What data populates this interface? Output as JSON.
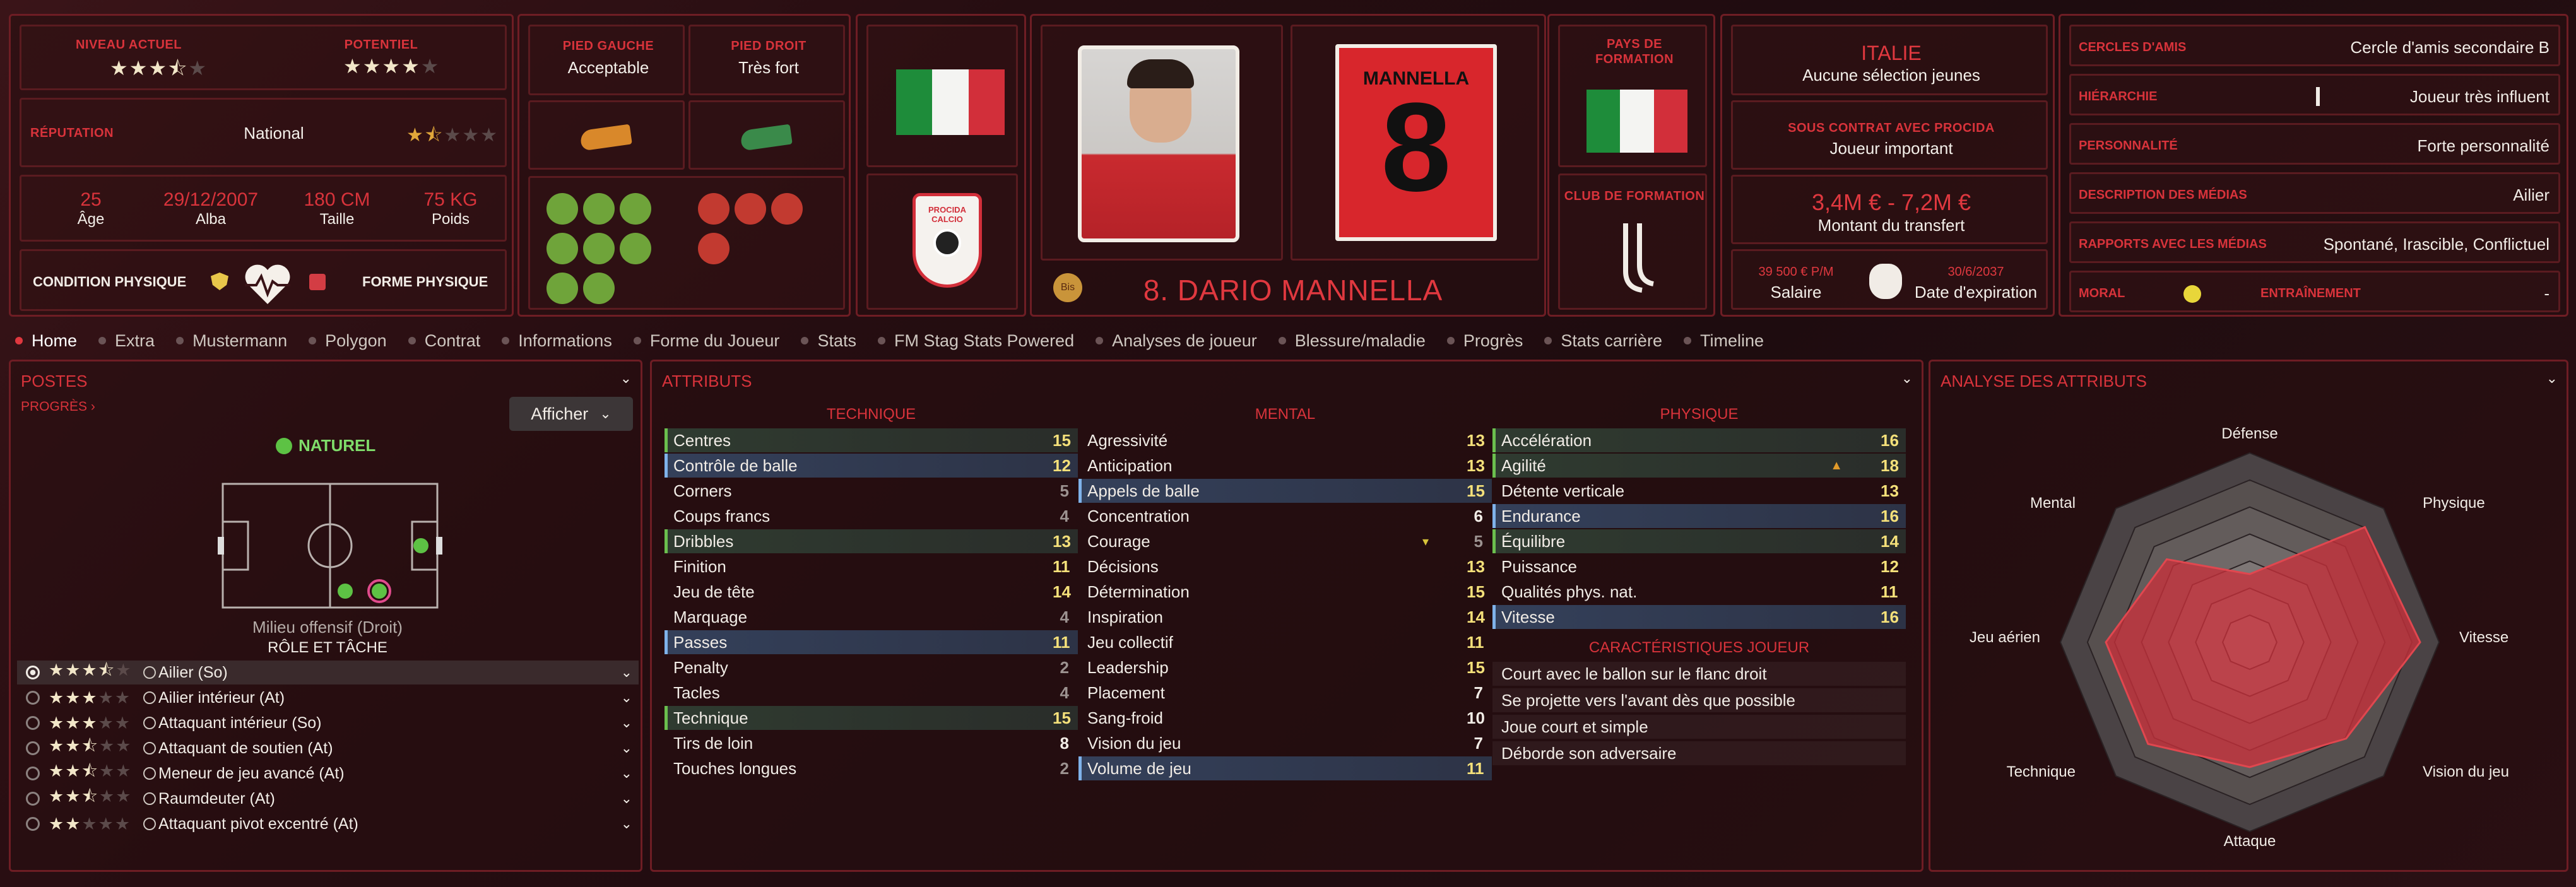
{
  "top": {
    "niveau_actuel_label": "NIVEAU ACTUEL",
    "niveau_actuel_stars": "★★★⯪",
    "niveau_actuel_empty": "★",
    "potentiel_label": "POTENTIEL",
    "potentiel_stars": "★★★★",
    "potentiel_empty": "★",
    "reputation_label": "RÉPUTATION",
    "reputation_value": "National",
    "reputation_stars": "★⯪",
    "reputation_empty": "★★★",
    "age_value": "25",
    "age_label": "Âge",
    "birth_value": "29/12/2007",
    "birth_label": "Alba",
    "height_value": "180 CM",
    "height_label": "Taille",
    "weight_value": "75 KG",
    "weight_label": "Poids",
    "condition_label": "CONDITION PHYSIQUE",
    "forme_label": "FORME PHYSIQUE",
    "pied_gauche_label": "PIED GAUCHE",
    "pied_gauche_value": "Acceptable",
    "pied_droit_label": "PIED DROIT",
    "pied_droit_value": "Très fort",
    "club_crest_text": "PROCIDA CALCIO",
    "shirt_name": "MANNELLA",
    "shirt_number": "8",
    "player_name": "8. DARIO MANNELLA",
    "player_badge": "Bis",
    "pays_formation_label": "PAYS DE FORMATION",
    "club_formation_label": "CLUB DE FORMATION",
    "nation_name": "ITALIE",
    "nation_caps": "Aucune sélection jeunes",
    "contract_label": "SOUS CONTRAT AVEC PROCIDA",
    "contract_value": "Joueur important",
    "transfer_value": "3,4M € - 7,2M €",
    "transfer_label": "Montant du transfert",
    "salary_value": "39 500 € P/M",
    "salary_label": "Salaire",
    "expiry_value": "30/6/2037",
    "expiry_label": "Date d'expiration"
  },
  "info": [
    {
      "label": "CERCLES D'AMIS",
      "value": "Cercle d'amis secondaire B"
    },
    {
      "label": "HIÉRARCHIE",
      "value": "Joueur très influent"
    },
    {
      "label": "PERSONNALITÉ",
      "value": "Forte personnalité"
    },
    {
      "label": "DESCRIPTION DES MÉDIAS",
      "value": "Ailier"
    },
    {
      "label": "RAPPORTS AVEC LES MÉDIAS",
      "value": "Spontané, Irascible, Conflictuel"
    },
    {
      "label": "MORAL",
      "value": ""
    },
    {
      "label": "ENTRAÎNEMENT",
      "value": "-"
    }
  ],
  "tabs": [
    "Home",
    "Extra",
    "Mustermann",
    "Polygon",
    "Contrat",
    "Informations",
    "Forme du Joueur",
    "Stats",
    "FM Stag Stats Powered",
    "Analyses de joueur",
    "Blessure/maladie",
    "Progrès",
    "Stats carrière",
    "Timeline"
  ],
  "postes": {
    "title": "POSTES",
    "progress_link": "PROGRÈS",
    "afficher": "Afficher",
    "naturel": "NATUREL",
    "position_name": "Milieu offensif (Droit)",
    "role_heading": "RÔLE ET TÂCHE",
    "roles": [
      {
        "stars": "★★★⯪",
        "empty": "★",
        "name": "Ailier (So)"
      },
      {
        "stars": "★★★",
        "empty": "★★",
        "name": "Ailier intérieur (At)"
      },
      {
        "stars": "★★★",
        "empty": "★★",
        "name": "Attaquant intérieur (So)"
      },
      {
        "stars": "★★⯪",
        "empty": "★★",
        "name": "Attaquant de soutien (At)"
      },
      {
        "stars": "★★⯪",
        "empty": "★★",
        "name": "Meneur de jeu avancé (At)"
      },
      {
        "stars": "★★⯪",
        "empty": "★★",
        "name": "Raumdeuter (At)"
      },
      {
        "stars": "★★",
        "empty": "★★★",
        "name": "Attaquant pivot excentré (At)"
      }
    ]
  },
  "attributs": {
    "title": "ATTRIBUTS",
    "technique_heading": "TECHNIQUE",
    "mental_heading": "MENTAL",
    "physique_heading": "PHYSIQUE",
    "technique": [
      {
        "name": "Centres",
        "value": "15"
      },
      {
        "name": "Contrôle de balle",
        "value": "12"
      },
      {
        "name": "Corners",
        "value": "5"
      },
      {
        "name": "Coups francs",
        "value": "4"
      },
      {
        "name": "Dribbles",
        "value": "13"
      },
      {
        "name": "Finition",
        "value": "11"
      },
      {
        "name": "Jeu de tête",
        "value": "14"
      },
      {
        "name": "Marquage",
        "value": "4"
      },
      {
        "name": "Passes",
        "value": "11"
      },
      {
        "name": "Penalty",
        "value": "2"
      },
      {
        "name": "Tacles",
        "value": "4"
      },
      {
        "name": "Technique",
        "value": "15"
      },
      {
        "name": "Tirs de loin",
        "value": "8"
      },
      {
        "name": "Touches longues",
        "value": "2"
      }
    ],
    "mental": [
      {
        "name": "Agressivité",
        "value": "13"
      },
      {
        "name": "Anticipation",
        "value": "13"
      },
      {
        "name": "Appels de balle",
        "value": "15"
      },
      {
        "name": "Concentration",
        "value": "6"
      },
      {
        "name": "Courage",
        "value": "5"
      },
      {
        "name": "Décisions",
        "value": "13"
      },
      {
        "name": "Détermination",
        "value": "15"
      },
      {
        "name": "Inspiration",
        "value": "14"
      },
      {
        "name": "Jeu collectif",
        "value": "11"
      },
      {
        "name": "Leadership",
        "value": "15"
      },
      {
        "name": "Placement",
        "value": "7"
      },
      {
        "name": "Sang-froid",
        "value": "10"
      },
      {
        "name": "Vision du jeu",
        "value": "7"
      },
      {
        "name": "Volume de jeu",
        "value": "11"
      }
    ],
    "physique": [
      {
        "name": "Accélération",
        "value": "16"
      },
      {
        "name": "Agilité",
        "value": "18"
      },
      {
        "name": "Détente verticale",
        "value": "13"
      },
      {
        "name": "Endurance",
        "value": "16"
      },
      {
        "name": "Équilibre",
        "value": "14"
      },
      {
        "name": "Puissance",
        "value": "12"
      },
      {
        "name": "Qualités phys. nat.",
        "value": "11"
      },
      {
        "name": "Vitesse",
        "value": "16"
      }
    ],
    "caracteristiques_heading": "CARACTÉRISTIQUES JOUEUR",
    "caracteristiques": [
      "Court avec le ballon sur le flanc droit",
      "Se projette vers l'avant dès que possible",
      "Joue court et simple",
      "Déborde son adversaire"
    ]
  },
  "analyse": {
    "title": "ANALYSE DES ATTRIBUTS",
    "labels": [
      "Défense",
      "Physique",
      "Vitesse",
      "Vision du jeu",
      "Attaque",
      "Technique",
      "Jeu aérien",
      "Mental"
    ]
  },
  "colors": {
    "accent": "#d8333b",
    "good": "#6bbf4e",
    "blue": "#7fb2ea"
  },
  "icons": [
    "boot-left-icon",
    "boot-right-icon",
    "heart-icon",
    "shirt-icon",
    "flag-italy-icon",
    "juventus-crest-icon",
    "money-bag-icon",
    "smiley-icon"
  ]
}
